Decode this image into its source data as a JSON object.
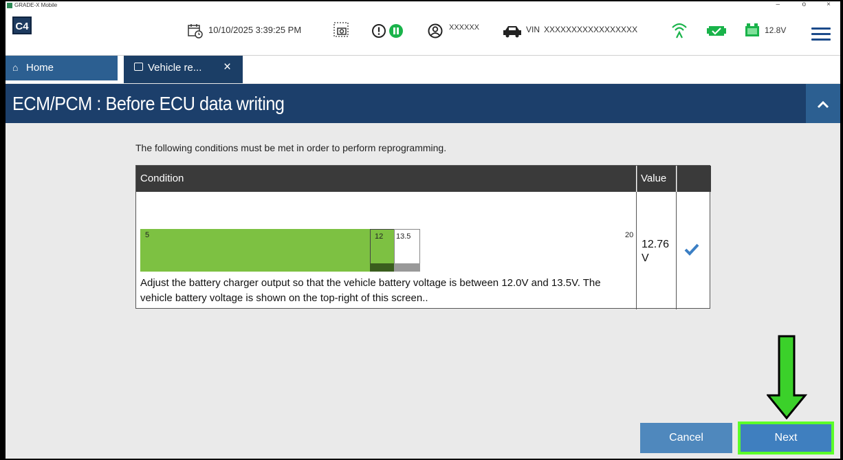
{
  "window": {
    "app_name": "GRADE-X Mobile",
    "minimize": "–",
    "restore": "o",
    "close": "×"
  },
  "toolbar": {
    "logo": "C4",
    "datetime": "10/10/2025 3:39:25 PM",
    "user": "XXXXXX",
    "vin_label": "VIN",
    "vin": "XXXXXXXXXXXXXXXXX",
    "voltage": "12.8V"
  },
  "tabs": [
    {
      "label": "Home"
    },
    {
      "label": "Vehicle re...",
      "close": "×"
    }
  ],
  "header": {
    "title": "ECM/PCM : Before ECU data writing"
  },
  "main": {
    "intro": "The following conditions must be met in order to perform reprogramming.",
    "table": {
      "headers": [
        "Condition",
        "Value",
        ""
      ],
      "rows": [
        {
          "gauge": {
            "min": "5",
            "low": "12",
            "high": "13.5",
            "max": "20",
            "current": 12.76
          },
          "text": "Adjust the battery charger output so that the vehicle battery voltage is between 12.0V and 13.5V. The vehicle battery voltage is shown on the top-right of this screen..",
          "value_num": "12.76",
          "value_unit": "V",
          "status": "ok"
        }
      ]
    }
  },
  "buttons": {
    "cancel": "Cancel",
    "next": "Next"
  },
  "colors": {
    "header_bg": "#1c3f6b",
    "button_bg": "#4f88bd",
    "gauge_green": "#7dc142",
    "highlight": "#5cff2a"
  }
}
